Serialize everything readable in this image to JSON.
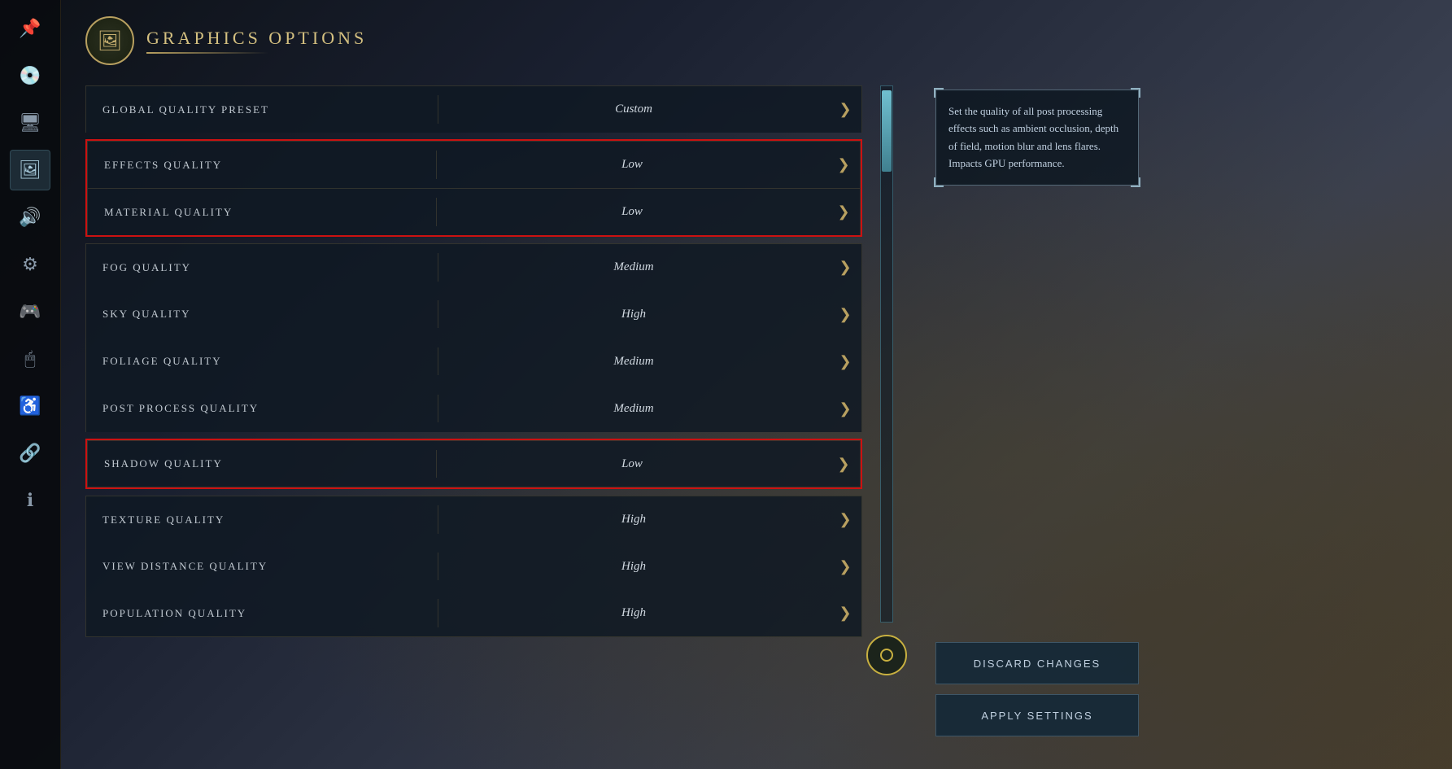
{
  "header": {
    "title": "GRAPHICS OPTIONS",
    "icon": "🖼"
  },
  "sidebar": {
    "icons": [
      {
        "id": "pin",
        "symbol": "📌",
        "active": false
      },
      {
        "id": "disc",
        "symbol": "💿",
        "active": false
      },
      {
        "id": "monitor",
        "symbol": "🖥",
        "active": false
      },
      {
        "id": "display",
        "symbol": "🖼",
        "active": true
      },
      {
        "id": "audio",
        "symbol": "🔊",
        "active": false
      },
      {
        "id": "gear",
        "symbol": "⚙",
        "active": false
      },
      {
        "id": "gamepad",
        "symbol": "🎮",
        "active": false
      },
      {
        "id": "mouse",
        "symbol": "🖱",
        "active": false
      },
      {
        "id": "accessibility",
        "symbol": "♿",
        "active": false
      },
      {
        "id": "share",
        "symbol": "🔗",
        "active": false
      },
      {
        "id": "info",
        "symbol": "ℹ",
        "active": false
      }
    ]
  },
  "settings": [
    {
      "id": "global-quality-preset",
      "label": "GLOBAL QUALITY PRESET",
      "value": "Custom",
      "highlighted": false,
      "group": null
    },
    {
      "id": "effects-quality",
      "label": "EFFECTS QUALITY",
      "value": "Low",
      "highlighted": true,
      "group": "group1"
    },
    {
      "id": "material-quality",
      "label": "MATERIAL QUALITY",
      "value": "Low",
      "highlighted": true,
      "group": "group1"
    },
    {
      "id": "fog-quality",
      "label": "FOG QUALITY",
      "value": "Medium",
      "highlighted": false,
      "group": null
    },
    {
      "id": "sky-quality",
      "label": "SKY QUALITY",
      "value": "High",
      "highlighted": false,
      "group": null
    },
    {
      "id": "foliage-quality",
      "label": "FOLIAGE QUALITY",
      "value": "Medium",
      "highlighted": false,
      "group": null
    },
    {
      "id": "post-process-quality",
      "label": "POST PROCESS QUALITY",
      "value": "Medium",
      "highlighted": false,
      "group": null
    },
    {
      "id": "shadow-quality",
      "label": "SHADOW QUALITY",
      "value": "Low",
      "highlighted": true,
      "group": "group2"
    },
    {
      "id": "texture-quality",
      "label": "TEXTURE QUALITY",
      "value": "High",
      "highlighted": false,
      "group": null
    },
    {
      "id": "view-distance-quality",
      "label": "VIEW DISTANCE QUALITY",
      "value": "High",
      "highlighted": false,
      "group": null
    },
    {
      "id": "population-quality",
      "label": "POPULATION QUALITY",
      "value": "High",
      "highlighted": false,
      "group": null
    }
  ],
  "info": {
    "description": "Set the quality of all post processing effects such as ambient occlusion, depth of field, motion blur and lens flares. Impacts GPU performance."
  },
  "buttons": {
    "discard": "DISCARD CHANGES",
    "apply": "APPLY SETTINGS"
  },
  "arrow_symbol": "❯"
}
